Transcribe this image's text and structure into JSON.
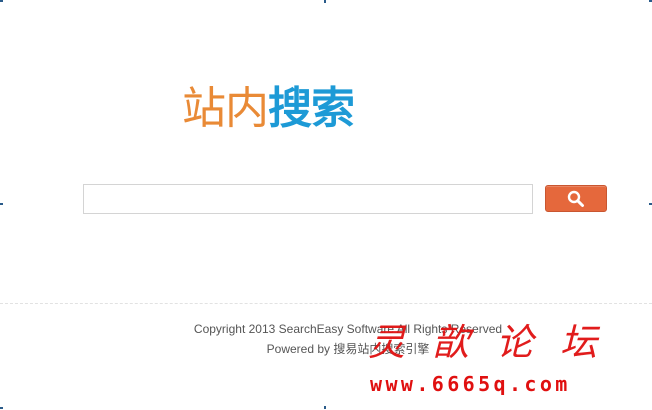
{
  "logo": {
    "part1": "站内",
    "part2": "搜索"
  },
  "search": {
    "value": "",
    "placeholder": ""
  },
  "search_button": {
    "icon": "search-icon"
  },
  "footer": {
    "copyright": "Copyright 2013 SearchEasy Software All Rights Reserved",
    "powered_by": "Powered by 搜易站内搜索引擎"
  },
  "watermark": {
    "title": "灵歆论坛",
    "url": "www.6665q.com"
  },
  "colors": {
    "logo_orange": "#e98a36",
    "logo_blue": "#1d9ad6",
    "button": "#e5683c",
    "watermark": "#e01010"
  }
}
